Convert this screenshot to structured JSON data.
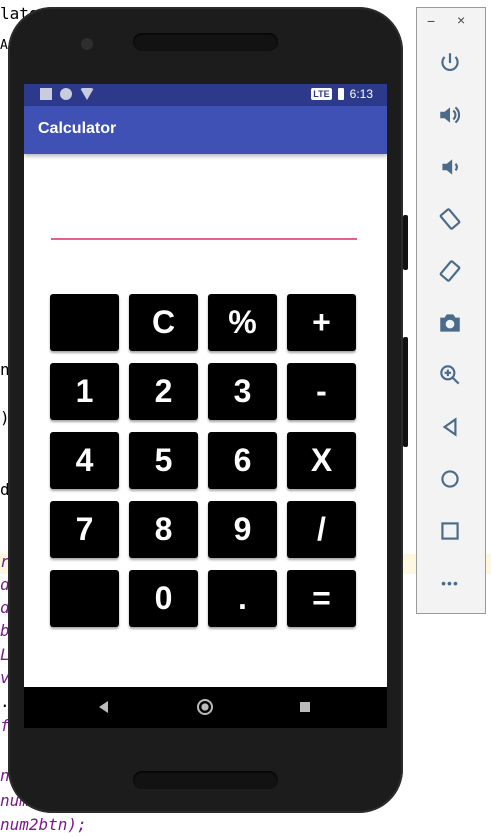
{
  "ide_fragments": {
    "top1": "lator",
    "top2": "Ad",
    "mid1": "n",
    "mid2": ")",
    "mid3": "d",
    "code_lines": [
      "r",
      "d",
      "d",
      "b",
      "L",
      "v",
      ".",
      "f",
      "n",
      "num",
      "num2btn);"
    ]
  },
  "status_bar": {
    "signal_label": "LTE",
    "time": "6:13"
  },
  "app": {
    "title": "Calculator",
    "display_value": "",
    "keys": [
      [
        "",
        "C",
        "%",
        "+"
      ],
      [
        "1",
        "2",
        "3",
        "-"
      ],
      [
        "4",
        "5",
        "6",
        "X"
      ],
      [
        "7",
        "8",
        "9",
        "/"
      ],
      [
        "",
        "0",
        ".",
        "="
      ]
    ]
  },
  "emulator_controls": {
    "minimize_label": "−",
    "close_label": "×",
    "more_label": "•••",
    "buttons": [
      "power-icon",
      "volume-up-icon",
      "volume-down-icon",
      "rotate-left-icon",
      "rotate-right-icon",
      "camera-icon",
      "zoom-in-icon",
      "back-icon",
      "home-icon",
      "overview-icon",
      "more-icon"
    ]
  },
  "colors": {
    "app_bar": "#3f51b5",
    "status_bar": "#2d3a8c",
    "accent_underline": "#e46091",
    "key_bg": "#000000",
    "key_fg": "#ffffff"
  }
}
